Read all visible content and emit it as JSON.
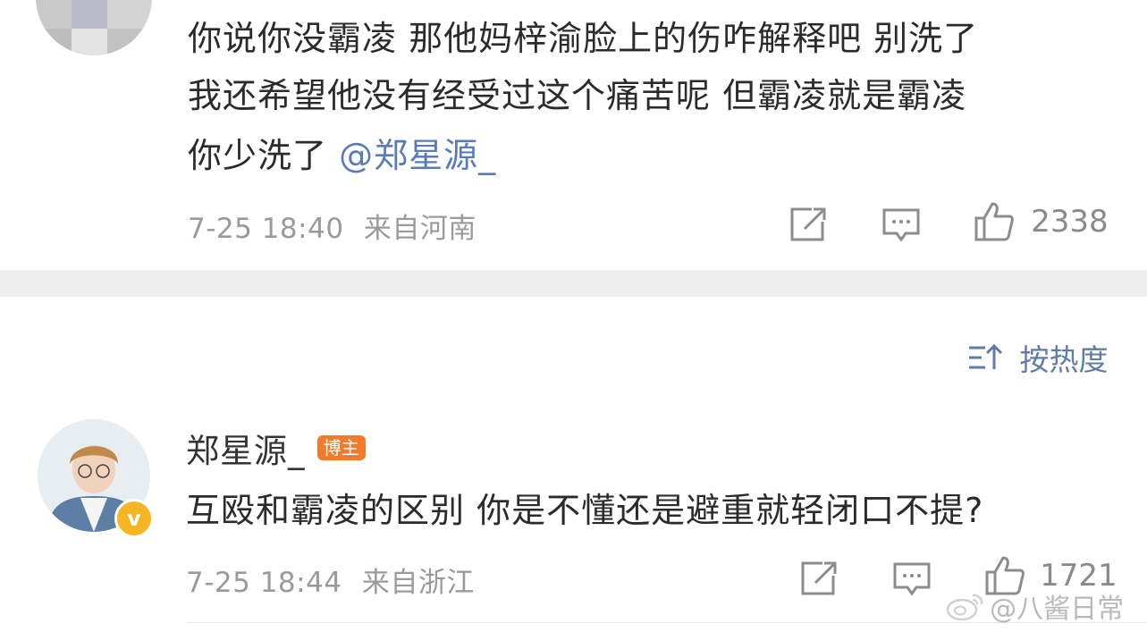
{
  "top_comment": {
    "line1": "你说你没霸凌 那他妈梓渝脸上的伤咋解释吧 别洗了",
    "line2": "我还希望他没有经受过这个痛苦呢 但霸凌就是霸凌",
    "line3_text": "你少洗了 ",
    "mention": "@郑星源_",
    "date": "7-25 18:40",
    "source": "来自河南",
    "like_count": "2338"
  },
  "sort": {
    "label": "按热度",
    "icon": "sort-icon"
  },
  "reply": {
    "username": "郑星源_",
    "badge": "博主",
    "verified_mark": "v",
    "text": "互殴和霸凌的区别 你是不懂还是避重就轻闭口不提?",
    "date": "7-25 18:44",
    "source": "来自浙江",
    "like_count": "1721"
  },
  "watermark": "@八酱日常",
  "colors": {
    "mention": "#5b7bb6",
    "badge": "#f27a2c",
    "verified": "#f5b623",
    "divider": "#eeeeee"
  }
}
